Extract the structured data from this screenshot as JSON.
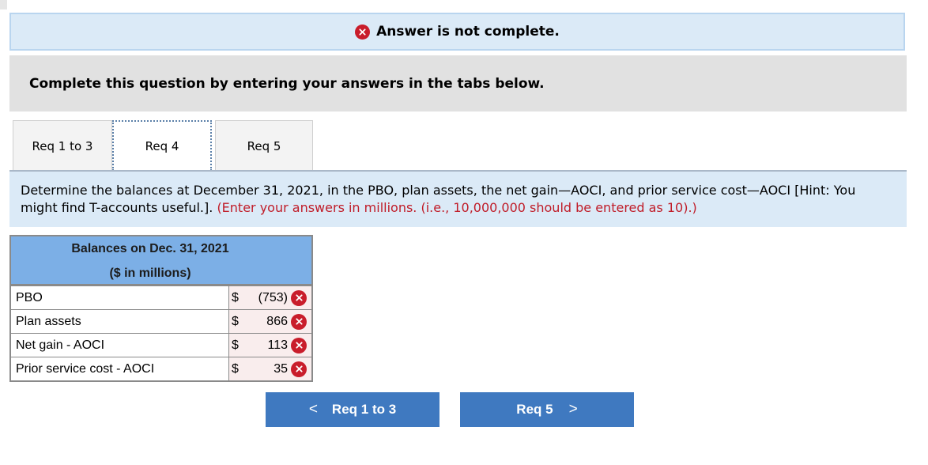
{
  "status": {
    "text": "Answer is not complete.",
    "icon": "x-circle-icon",
    "color": "#c91d2b"
  },
  "instruction": "Complete this question by entering your answers in the tabs below.",
  "tabs": [
    {
      "label": "Req 1 to 3",
      "active": false
    },
    {
      "label": "Req 4",
      "active": true
    },
    {
      "label": "Req 5",
      "active": false
    }
  ],
  "question": {
    "text": "Determine the balances at December 31, 2021, in the PBO, plan assets, the net gain—AOCI, and prior service cost—AOCI [Hint: You might find T-accounts useful.].",
    "note": "(Enter your answers in millions. (i.e., 10,000,000 should be entered as 10).)"
  },
  "table": {
    "header_line1": "Balances on Dec. 31, 2021",
    "header_line2": "($ in millions)",
    "rows": [
      {
        "label": "PBO",
        "currency": "$",
        "value": "(753)",
        "status": "incorrect"
      },
      {
        "label": "Plan assets",
        "currency": "$",
        "value": "866",
        "status": "incorrect"
      },
      {
        "label": "Net gain - AOCI",
        "currency": "$",
        "value": "113",
        "status": "incorrect"
      },
      {
        "label": "Prior service cost - AOCI",
        "currency": "$",
        "value": "35",
        "status": "incorrect"
      }
    ]
  },
  "nav": {
    "prev_label": "Req 1 to 3",
    "next_label": "Req 5",
    "button_color": "#3f79c0"
  }
}
